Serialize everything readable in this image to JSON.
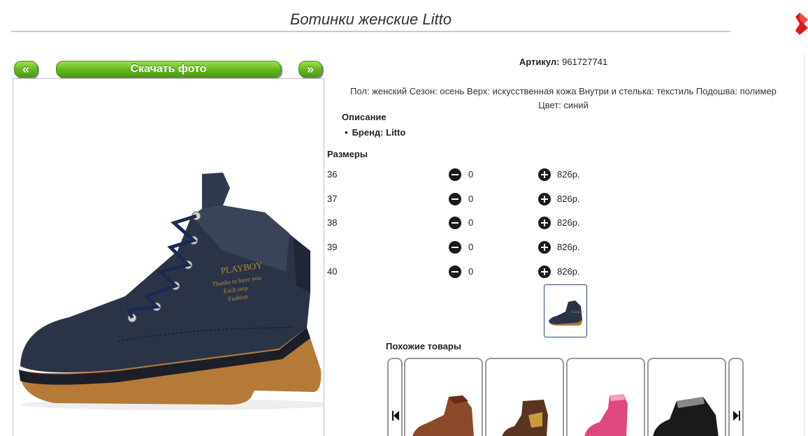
{
  "page": {
    "title": "Ботинки женские Litto"
  },
  "gallery": {
    "prev_label": "«",
    "download_label": "Скачать фото",
    "next_label": "»"
  },
  "article": {
    "label": "Артикул:",
    "value": "961727741"
  },
  "description": {
    "line1": "Пол: женский Сезон: осень Верх: искусственная кожа Внутри и стелька: текстиль Подошва: полимер",
    "line2": "Цвет: синий",
    "heading": "Описание",
    "brand": "Бренд: Litto"
  },
  "sizes": {
    "heading": "Размеры",
    "rows": [
      {
        "size": "36",
        "qty": "0",
        "price": "826р."
      },
      {
        "size": "37",
        "qty": "0",
        "price": "826р."
      },
      {
        "size": "38",
        "qty": "0",
        "price": "826р."
      },
      {
        "size": "39",
        "qty": "0",
        "price": "826р."
      },
      {
        "size": "40",
        "qty": "0",
        "price": "826р."
      }
    ]
  },
  "similar": {
    "heading": "Похожие товары",
    "items": [
      {
        "color": "#8a4a2a",
        "accent": "#6b2b1a"
      },
      {
        "color": "#5a3420",
        "accent": "#c89a3a"
      },
      {
        "color": "#e0477f",
        "accent": "#f2a0c0"
      },
      {
        "color": "#1a1a1a",
        "accent": "#888888"
      }
    ]
  },
  "colors": {
    "accent_green": "#63b51c",
    "boot_navy": "#2b3446",
    "sole_tan": "#b57a38"
  }
}
